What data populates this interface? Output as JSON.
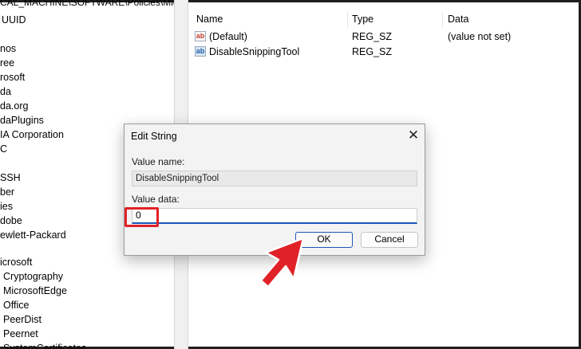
{
  "address_bar": "CAL_MACHINE\\SOFTWARE\\Policies\\Microsoft\\TabletPC",
  "tree_items": [
    "UUID",
    "",
    "nos",
    "ree",
    "rosoft",
    "da",
    "da.org",
    "daPlugins",
    "IA Corporation",
    "C",
    "",
    "SSH",
    "ber",
    "ies",
    "dobe",
    "ewlett-Packard",
    "",
    "icrosoft",
    "Cryptography",
    "MicrosoftEdge",
    "Office",
    "PeerDist",
    "Peernet",
    "SystemCertificates"
  ],
  "list": {
    "headers": {
      "name": "Name",
      "type": "Type",
      "data": "Data"
    },
    "rows": [
      {
        "icon": "string-value-icon",
        "icon_text": "ab",
        "name": "(Default)",
        "type": "REG_SZ",
        "data": "(value not set)"
      },
      {
        "icon": "string-value-icon",
        "icon_text": "ab",
        "name": "DisableSnippingTool",
        "type": "REG_SZ",
        "data": ""
      }
    ]
  },
  "dialog": {
    "title": "Edit String",
    "close_glyph": "✕",
    "value_name_label": "Value name:",
    "value_name": "DisableSnippingTool",
    "value_data_label": "Value data:",
    "value_data": "0",
    "ok_label": "OK",
    "cancel_label": "Cancel"
  },
  "colors": {
    "accent": "#1a56b8",
    "annotation_red": "#e02228"
  }
}
